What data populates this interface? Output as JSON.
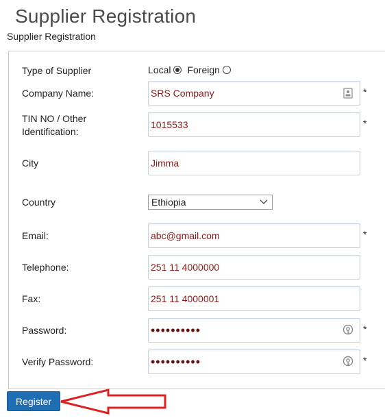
{
  "header": {
    "title": "Supplier Registration",
    "subtitle": "Supplier Registration"
  },
  "form": {
    "supplier_type": {
      "label": "Type of Supplier",
      "options": [
        {
          "label": "Local",
          "selected": true
        },
        {
          "label": "Foreign",
          "selected": false
        }
      ]
    },
    "company_name": {
      "label": "Company Name:",
      "value": "SRS Company",
      "required": "*",
      "icon": "contact-card-icon"
    },
    "tin_no": {
      "label_line1": "TIN NO / Other",
      "label_line2": "Identification:",
      "value": "1015533",
      "required": "*"
    },
    "city": {
      "label": "City",
      "value": "Jimma"
    },
    "country": {
      "label": "Country",
      "value": "Ethiopia"
    },
    "email": {
      "label": "Email:",
      "value": "abc@gmail.com",
      "required": "*"
    },
    "telephone": {
      "label": "Telephone:",
      "value": "251 11 4000000"
    },
    "fax": {
      "label": "Fax:",
      "value": "251 11 4000001"
    },
    "password": {
      "label": "Password:",
      "value": "••••••••••",
      "required": "*",
      "icon": "key-icon"
    },
    "verify_password": {
      "label": "Verify Password:",
      "value": "••••••••••",
      "required": "*",
      "icon": "key-icon"
    }
  },
  "actions": {
    "register_label": "Register"
  },
  "colors": {
    "button": "#1f6eb3",
    "value_text": "#8b1a1a",
    "annotation_arrow": "#e02020"
  }
}
